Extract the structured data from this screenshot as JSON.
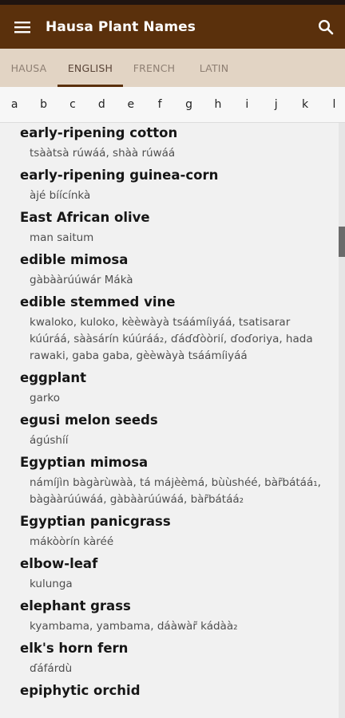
{
  "app": {
    "title": "Hausa Plant Names"
  },
  "icons": {
    "menu": "menu-icon",
    "search": "search-icon"
  },
  "colors": {
    "appbar": "#5a300c",
    "tabs_bg": "#e2d4c4",
    "status_bar": "#1f1410"
  },
  "tabs": [
    {
      "label": "HAUSA",
      "active": false
    },
    {
      "label": "ENGLISH",
      "active": true
    },
    {
      "label": "FRENCH",
      "active": false
    },
    {
      "label": "LATIN",
      "active": false
    }
  ],
  "letters": [
    "a",
    "b",
    "c",
    "d",
    "e",
    "f",
    "g",
    "h",
    "i",
    "j",
    "k",
    "l"
  ],
  "entries": [
    {
      "english": "early-ripening cotton",
      "hausa": "tsààtsà rúwáá, shàà rúwáá"
    },
    {
      "english": "early-ripening guinea-corn",
      "hausa": "àjé bíícínkà"
    },
    {
      "english": "East African olive",
      "hausa": "man saitum"
    },
    {
      "english": "edible mimosa",
      "hausa": "gàbààrúúwár Mákà"
    },
    {
      "english": "edible stemmed vine",
      "hausa": "kwaloko, kuloko, kèèwàyà tsáámíiyáá, tsatisarar kúúráá, sààsárín kúúráá₂, ɗáɗɗòòrií, ɗoɗoriya, hada rawaki, gaba gaba, gèèwàyà tsáámíiyáá"
    },
    {
      "english": "eggplant",
      "hausa": "garko"
    },
    {
      "english": "egusi melon seeds",
      "hausa": "ágúshíí"
    },
    {
      "english": "Egyptian mimosa",
      "hausa": "námíjìn bàgàrùwàà, tá májèèmá, bùùshéé, bàr̃bátáá₁, bàgààrúúwáá, gàbààrúúwáá, bàr̃bátáá₂"
    },
    {
      "english": "Egyptian panicgrass",
      "hausa": "mákòòrín kàréé"
    },
    {
      "english": "elbow-leaf",
      "hausa": "kulunga"
    },
    {
      "english": "elephant grass",
      "hausa": "kyambama, yambama, dáàwàr̃ kádàà₂"
    },
    {
      "english": "elk's horn fern",
      "hausa": "ɗáfárdù"
    },
    {
      "english": "epiphytic orchid",
      "hausa": ""
    }
  ]
}
